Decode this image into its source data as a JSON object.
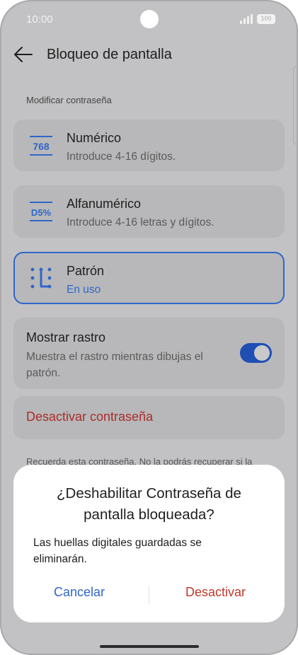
{
  "status_bar": {
    "time": "10:00",
    "battery": "100",
    "signal_icon": "signal-icon",
    "battery_icon": "battery-icon"
  },
  "header": {
    "title": "Bloqueo de pantalla",
    "back_icon": "arrow-left-icon"
  },
  "section": {
    "label": "Modificar contraseña"
  },
  "options": [
    {
      "icon_text": "768",
      "icon": "numeric-keypad-icon",
      "title": "Numérico",
      "subtitle": "Introduce 4-16 dígitos."
    },
    {
      "icon_text": "D5%",
      "icon": "alphanumeric-icon",
      "title": "Alfanumérico",
      "subtitle": "Introduce 4-16 letras y dígitos."
    },
    {
      "icon": "pattern-icon",
      "title": "Patrón",
      "subtitle": "En uso",
      "selected": true
    }
  ],
  "show_trail": {
    "title": "Mostrar rastro",
    "line1": "Muestra el rastro mientras dibujas el",
    "line2": "patrón.",
    "enabled": true
  },
  "disable_password": {
    "label": "Desactivar contraseña"
  },
  "note": {
    "text": "Recuerda esta contraseña. No la podrás recuperar si la"
  },
  "dialog": {
    "title_line1": "¿Deshabilitar Contraseña de",
    "title_line2": "pantalla bloqueada?",
    "message_line1": "Las huellas digitales guardadas se",
    "message_line2": "eliminarán.",
    "cancel_label": "Cancelar",
    "confirm_label": "Desactivar"
  },
  "colors": {
    "accent": "#2f66c8",
    "danger": "#c0392b",
    "card": "#b8b8ba",
    "background": "#c2c2c4"
  }
}
